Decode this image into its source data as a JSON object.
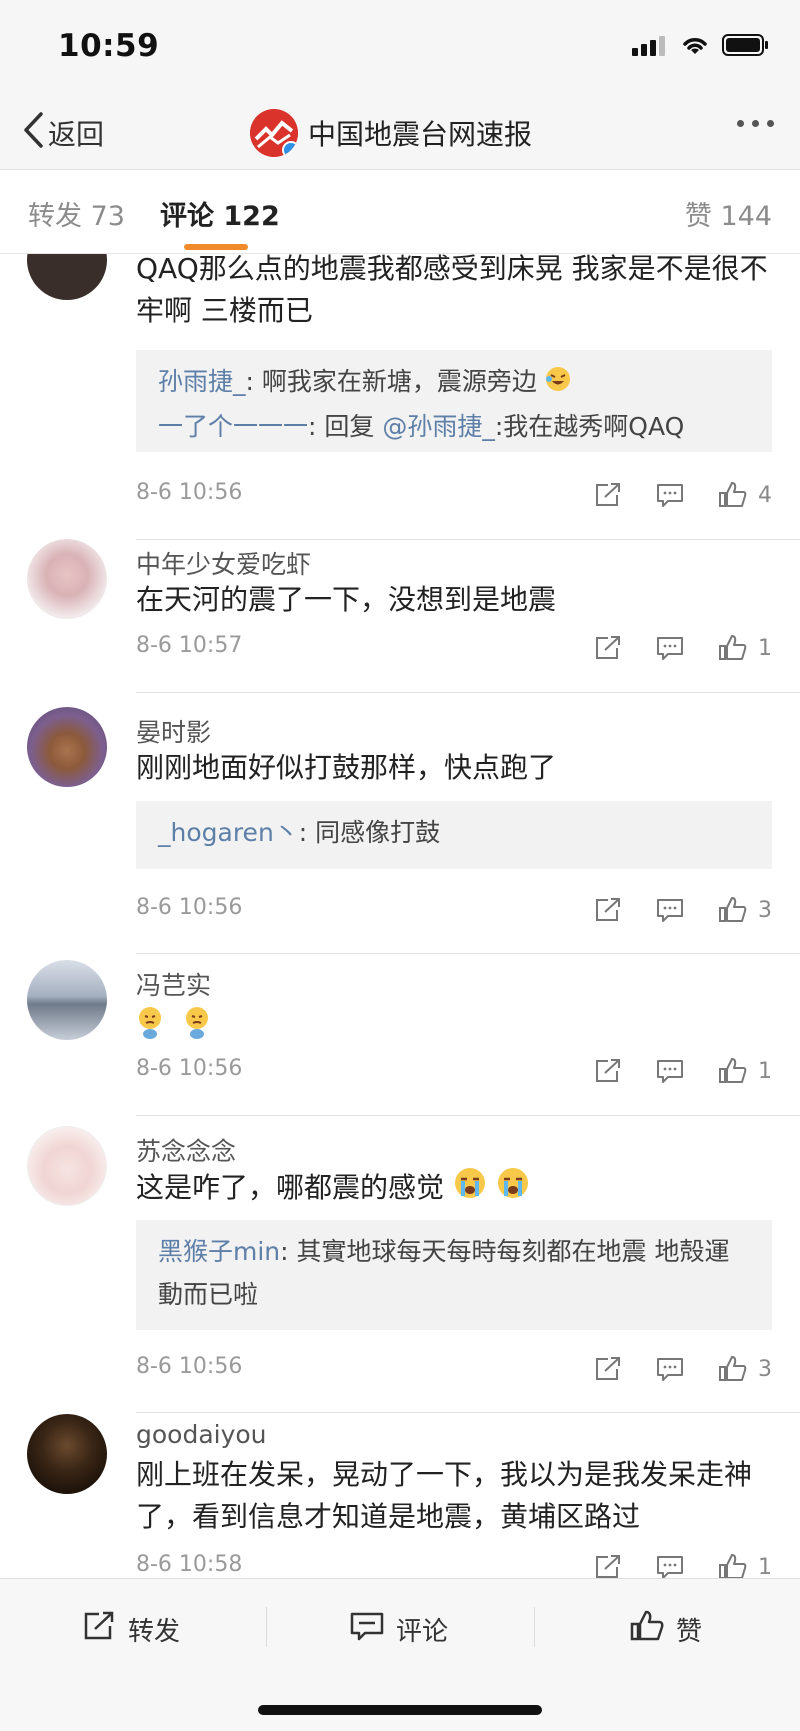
{
  "status_bar": {
    "time": "10:59"
  },
  "nav": {
    "back_label": "返回",
    "title": "中国地震台网速报"
  },
  "tabs": {
    "repost": "转发 73",
    "comments": "评论 122",
    "likes": "赞 144"
  },
  "comments": [
    {
      "name": "",
      "text": "QAQ那么点的地震我都感受到床晃 我家是不是很不牢啊 三楼而已",
      "replies": [
        {
          "user": "孙雨捷_",
          "text": ": 啊我家在新塘，震源旁边"
        },
        {
          "user": "一了个一一一",
          "text": ": 回复 ",
          "mention": "@孙雨捷_",
          "text2": ":我在越秀啊QAQ"
        }
      ],
      "time": "8-6 10:56",
      "likes": "4"
    },
    {
      "name": "中年少女爱吃虾",
      "text": "在天河的震了一下，没想到是地震",
      "time": "8-6 10:57",
      "likes": "1"
    },
    {
      "name": "晏时影",
      "text": "刚刚地面好似打鼓那样，快点跑了",
      "replies": [
        {
          "user": "_hogaren丶",
          "text": ": 同感像打鼓"
        }
      ],
      "time": "8-6 10:56",
      "likes": "3"
    },
    {
      "name": "冯芑实",
      "text": "",
      "time": "8-6 10:56",
      "likes": "1"
    },
    {
      "name": "苏念念念",
      "text": "这是咋了，哪都震的感觉",
      "replies": [
        {
          "user": "黑猴子min",
          "text": ": 其實地球每天每時每刻都在地震 地殻運動而已啦"
        }
      ],
      "time": "8-6 10:56",
      "likes": "3"
    },
    {
      "name": "goodaiyou",
      "text": "刚上班在发呆，晃动了一下，我以为是我发呆走神了，看到信息才知道是地震，黄埔区路过",
      "time": "8-6 10:58",
      "likes": "1"
    }
  ],
  "bottom_bar": {
    "repost": "转发",
    "comment": "评论",
    "like": "赞"
  },
  "colors": {
    "accent_underline": "#f08a2b",
    "link_blue": "#5d7fa8",
    "logo_red": "#d9332c",
    "verified_blue": "#2d8fe5"
  },
  "icons": [
    "back-chevron-icon",
    "signal-icon",
    "wifi-icon",
    "battery-icon",
    "more-icon",
    "share-icon",
    "comment-icon",
    "like-icon",
    "laugh-cry-emoji",
    "crying-emoji",
    "sweat-emoji"
  ]
}
